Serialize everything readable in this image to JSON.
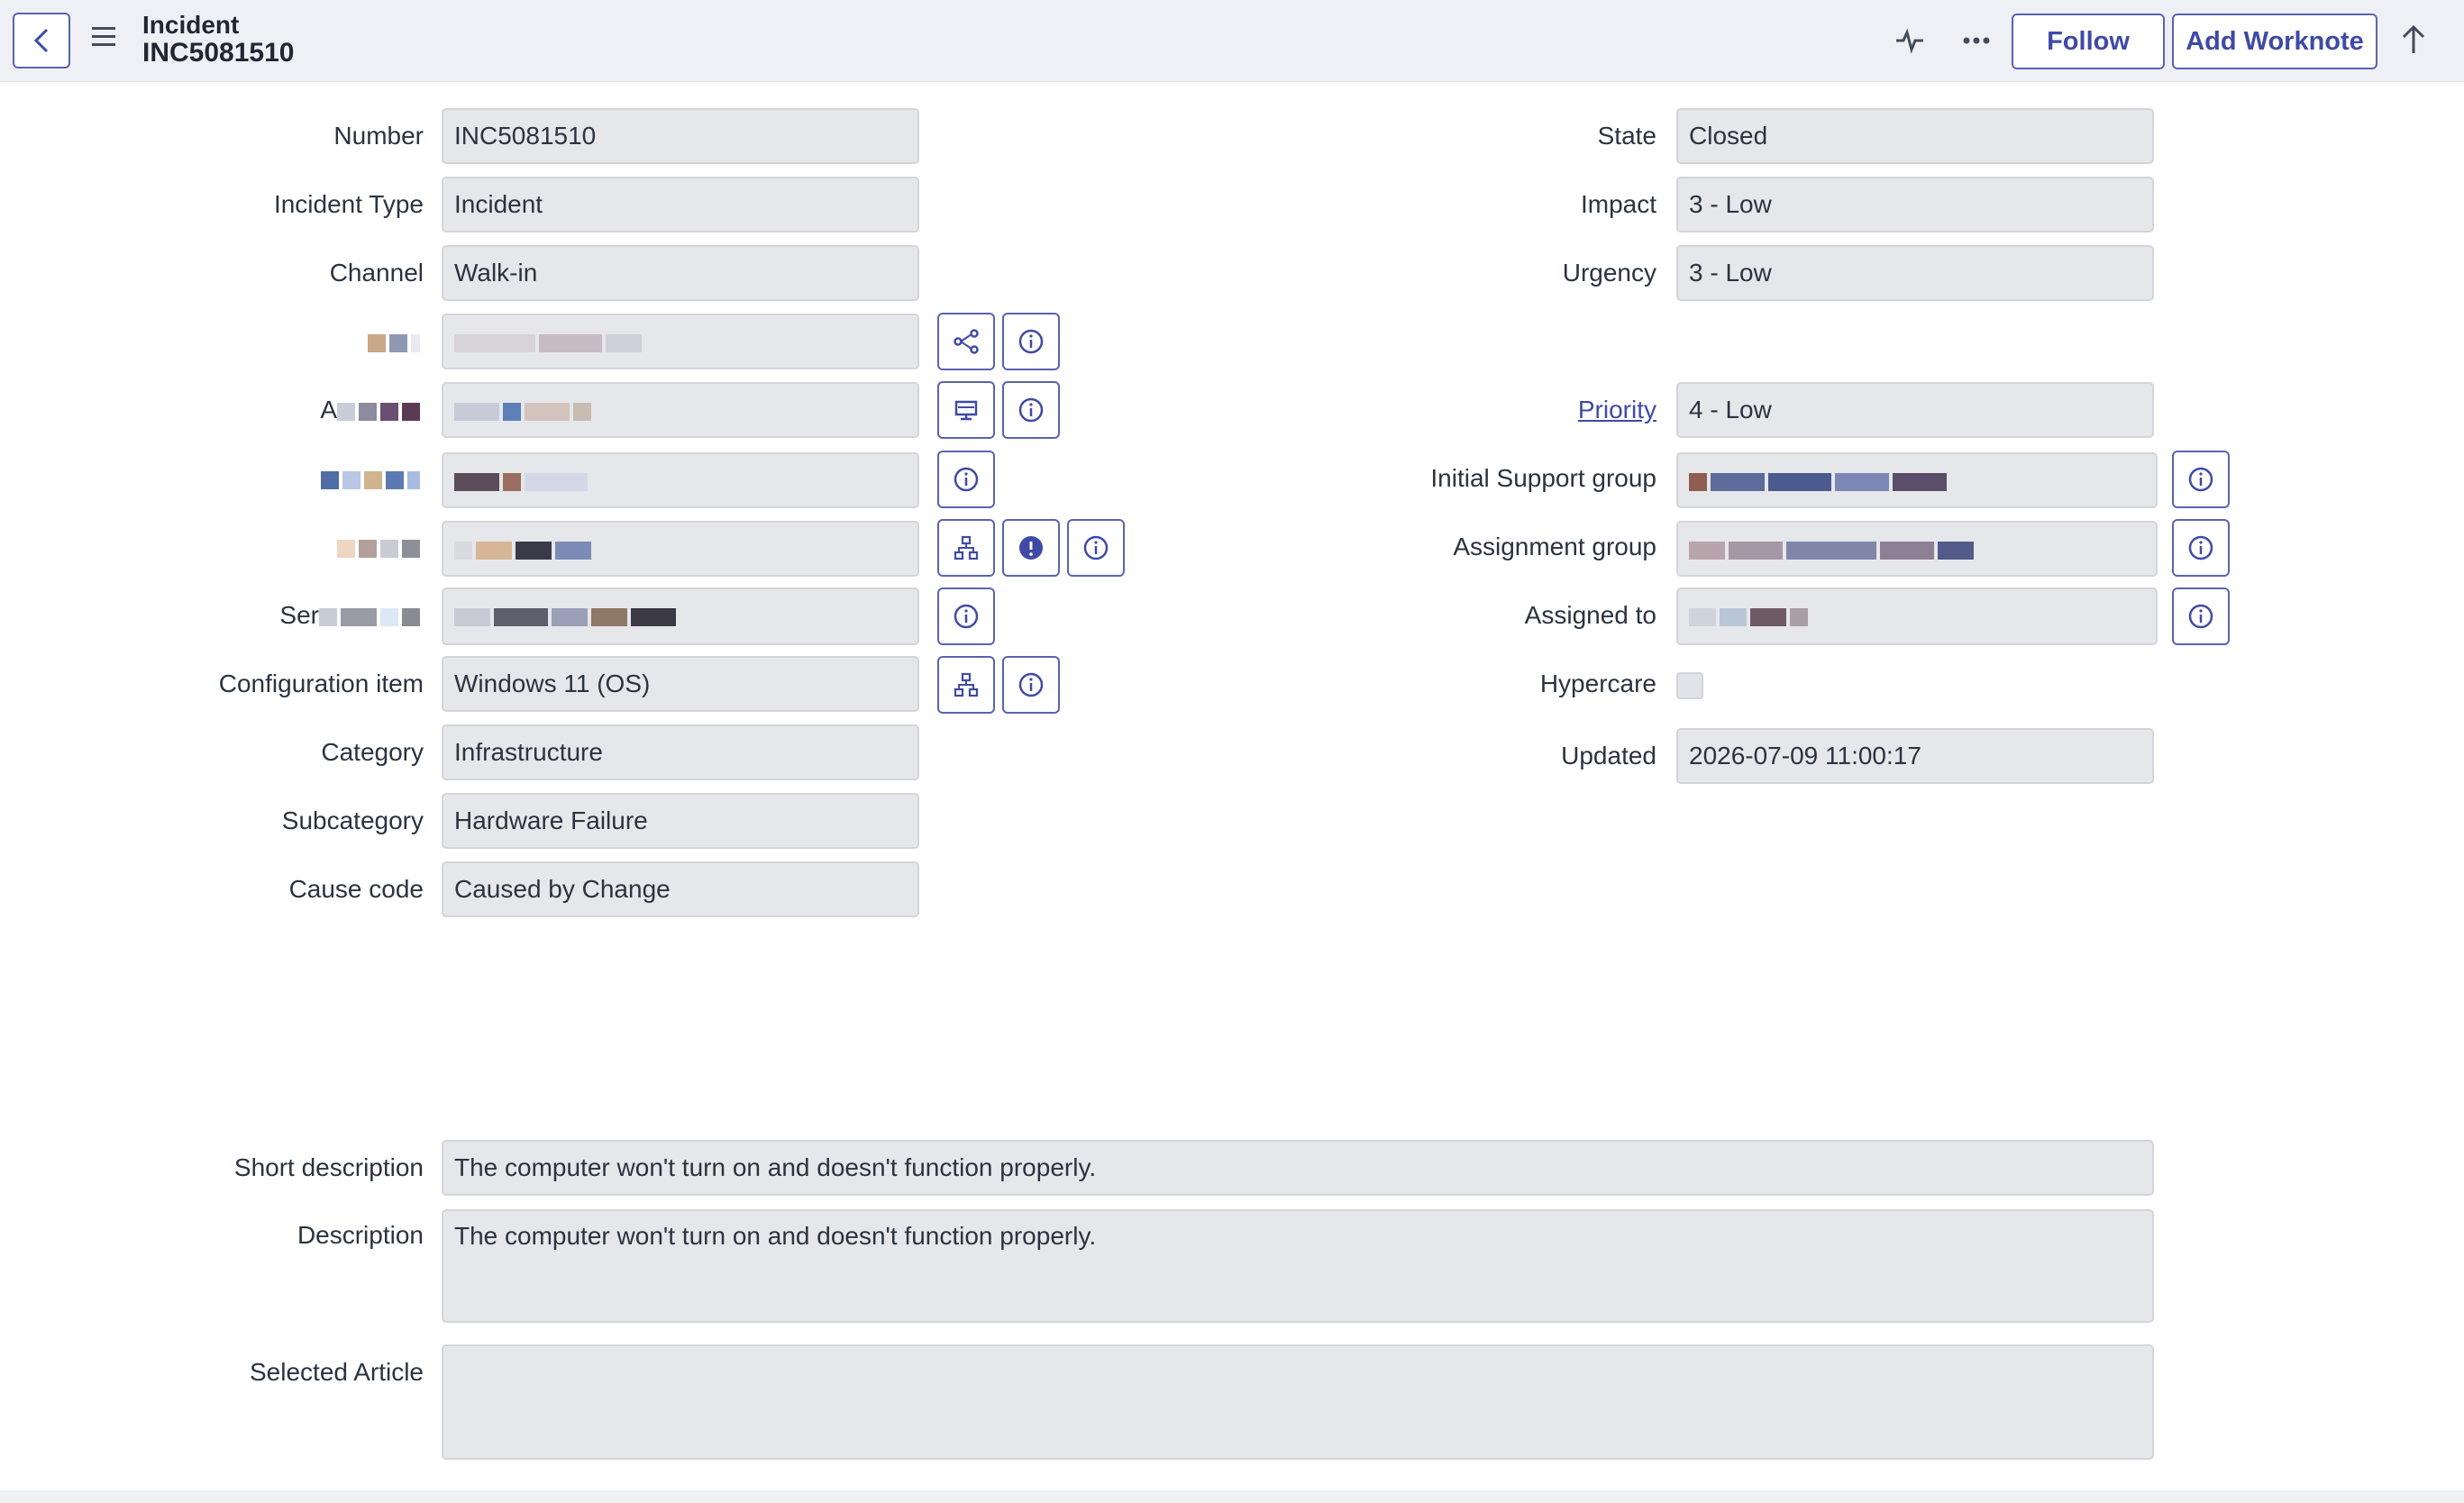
{
  "header": {
    "title": "Incident",
    "subtitle": "INC5081510",
    "follow_label": "Follow",
    "worknote_label": "Add Worknote"
  },
  "left_fields": {
    "number": {
      "label": "Number",
      "value": "INC5081510"
    },
    "incident_type": {
      "label": "Incident Type",
      "value": "Incident"
    },
    "channel": {
      "label": "Channel",
      "value": "Walk-in"
    },
    "row4_label_fragment": "",
    "row5_label_fragment": "A",
    "row8_label_fragment": "Ser",
    "configuration_item": {
      "label": "Configuration item",
      "value": "Windows 11 (OS)"
    },
    "category": {
      "label": "Category",
      "value": "Infrastructure"
    },
    "subcategory": {
      "label": "Subcategory",
      "value": "Hardware Failure"
    },
    "cause_code": {
      "label": "Cause code",
      "value": "Caused by Change"
    }
  },
  "right_fields": {
    "state": {
      "label": "State",
      "value": "Closed"
    },
    "impact": {
      "label": "Impact",
      "value": "3 - Low"
    },
    "urgency": {
      "label": "Urgency",
      "value": "3 - Low"
    },
    "priority": {
      "label": "Priority",
      "value": "4 - Low"
    },
    "initial_support_group": {
      "label": "Initial Support group"
    },
    "assignment_group": {
      "label": "Assignment group"
    },
    "assigned_to": {
      "label": "Assigned to"
    },
    "hypercare": {
      "label": "Hypercare",
      "checked": false
    },
    "updated": {
      "label": "Updated",
      "value": "2026-07-09 11:00:17"
    }
  },
  "wide_fields": {
    "short_description": {
      "label": "Short description",
      "value": "The computer won't turn on and doesn't function properly."
    },
    "description": {
      "label": "Description",
      "value": "The computer won't turn on and doesn't function properly."
    },
    "selected_article": {
      "label": "Selected Article",
      "value": ""
    }
  },
  "colors": {
    "accent": "#3f4aa6",
    "field_bg": "#e6e7ea",
    "header_bg": "#eef0f5"
  },
  "icons": [
    "back-icon",
    "menu-icon",
    "pulse-icon",
    "more-icon",
    "up-arrow-icon",
    "network-icon",
    "info-icon",
    "monitor-icon",
    "hierarchy-icon",
    "alert-icon"
  ]
}
